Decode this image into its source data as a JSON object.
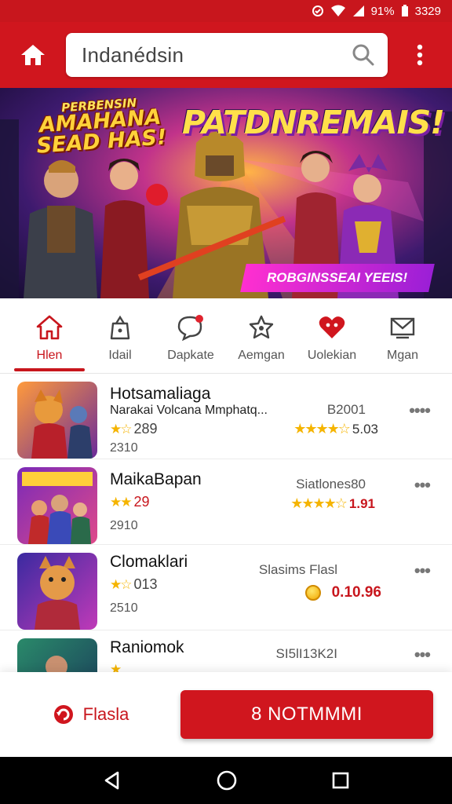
{
  "status_bar": {
    "battery": "91%",
    "time": "3329"
  },
  "header": {
    "search_value": "Indanédsin"
  },
  "banner": {
    "title_left": "AMAHANA SEAD HAS!",
    "title_left_top": "PERBENSIN",
    "title_main": "PATDNREMAIS!",
    "ribbon": "ROBGINSSEAI YEEIS!"
  },
  "tabs": [
    {
      "label": "Hlen",
      "icon": "home-icon",
      "active": true
    },
    {
      "label": "Idail",
      "icon": "bag-icon",
      "active": false
    },
    {
      "label": "Dapkate",
      "icon": "chat-icon",
      "active": false
    },
    {
      "label": "Aemgan",
      "icon": "star-badge-icon",
      "active": false
    },
    {
      "label": "Uolekian",
      "icon": "heart-icon",
      "active": false
    },
    {
      "label": "Mgan",
      "icon": "mail-icon",
      "active": false
    }
  ],
  "games": [
    {
      "title": "Hotsamaliaga",
      "subtitle": "Narakai Volcana Mmphatq...",
      "rating": "289",
      "count": "2310",
      "right_label": "B2001",
      "right_rating": "5.03",
      "more": "••••"
    },
    {
      "title": "MaikaBapan",
      "subtitle": "",
      "rating": "29",
      "count": "2910",
      "right_label": "Siatlones80",
      "right_rating": "1.91",
      "more": "•••"
    },
    {
      "title": "Clomaklari",
      "subtitle": "",
      "rating": "013",
      "count": "2510",
      "right_label": "Slasims Flasl",
      "right_rating": "0.10.96",
      "more": "•••"
    },
    {
      "title": "Raniomok",
      "subtitle": "",
      "rating": "",
      "count": "",
      "right_label": "SI5lI13K2I",
      "right_rating": "",
      "more": "•••"
    }
  ],
  "bottom": {
    "flash_label": "Flasla",
    "primary_label": "8 NOTMMMI"
  },
  "colors": {
    "brand_red": "#d0161e",
    "star_gold": "#f5b400"
  }
}
